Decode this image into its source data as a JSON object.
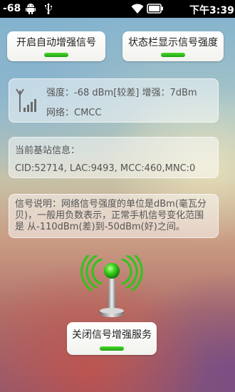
{
  "status_bar": {
    "signal_value": "-68",
    "time": "下午3:39",
    "icons": [
      "android-icon",
      "usb-icon",
      "wifi-icon",
      "battery-icon"
    ]
  },
  "buttons": {
    "auto_boost": "开启自动增强信号",
    "statusbar_show": "状态栏显示信号强度",
    "close_service": "关闭信号增强服务"
  },
  "signal_info": {
    "strength_line": "强度：-68 dBm[较差]  增强：7dBm",
    "network_line": "网络：CMCC"
  },
  "station_info": {
    "title": "当前基站信息：",
    "value": "CID:52714, LAC:9493, MCC:460,MNC:0"
  },
  "description": "信号说明：网络信号强度的单位是dBm(毫瓦分 贝)，一般用负数表示，正常手机信号变化范围是 从-110dBm(差)到-50dBm(好)之间。",
  "colors": {
    "indicator_green": "#2fc41a",
    "status_bar_bg": "#000000"
  }
}
